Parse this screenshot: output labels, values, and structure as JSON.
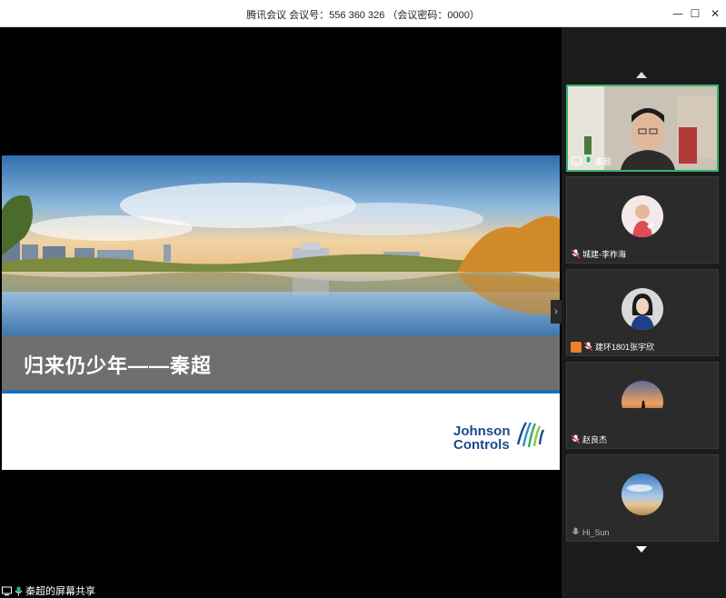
{
  "window": {
    "title": "腾讯会议 会议号：556 360 326 （会议密码：0000）",
    "minimize_glyph": "—",
    "maximize_glyph": "☐",
    "close_glyph": "✕"
  },
  "share": {
    "presenter_label": "秦超的屏幕共享",
    "next_glyph": "›",
    "slide": {
      "title": "归来仍少年——秦超",
      "logo_line1": "Johnson",
      "logo_line2": "Controls"
    }
  },
  "participants": [
    {
      "name": "秦超",
      "mic": "on",
      "video": true
    },
    {
      "name": "城建-李祚海",
      "mic": "muted"
    },
    {
      "name": "建环1801张宇欣",
      "mic": "muted",
      "badge": "host"
    },
    {
      "name": "赵良杰",
      "mic": "muted"
    },
    {
      "name": "Hi_Sun",
      "mic": "muted"
    }
  ],
  "colors": {
    "accent_green": "#35b26b",
    "slide_blue_line": "#1f6fb8",
    "logo_blue": "#1a4a8c",
    "host_badge": "#e8822b"
  },
  "icons": [
    "screen-share-icon",
    "mic-icon",
    "mic-muted-icon",
    "scroll-up-icon",
    "scroll-down-icon"
  ]
}
